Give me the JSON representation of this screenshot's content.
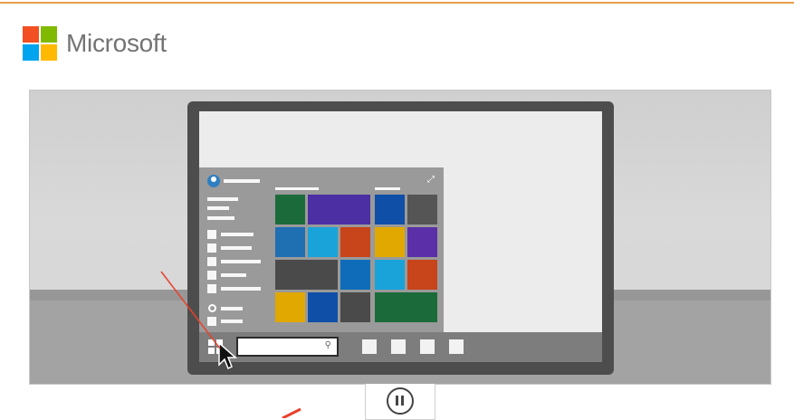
{
  "brand": {
    "name": "Microsoft",
    "logo_colors": [
      "#f25022",
      "#7fba00",
      "#00a4ef",
      "#ffb900"
    ]
  },
  "accent_line_color": "#e8a04a",
  "annotation_color": "#e8412c",
  "start_menu": {
    "tile_colors": [
      "#1b6b3a",
      "#4b2fa3",
      "#0f4fa8",
      "#555555",
      "#1f6fb3",
      "#1aa3d8",
      "#c8441a",
      "#e0a800",
      "#5b2fa8",
      "#4a4a4a",
      "#0f6cb8",
      "#1aa3d8",
      "#c8441a",
      "#e0a800",
      "#0f4fa8",
      "#4a4a4a",
      "#1b6b3a"
    ]
  },
  "icons": [
    "windows-start-icon",
    "search-icon",
    "power-icon",
    "expand-icon",
    "user-icon",
    "pause-icon",
    "mouse-cursor-icon"
  ]
}
